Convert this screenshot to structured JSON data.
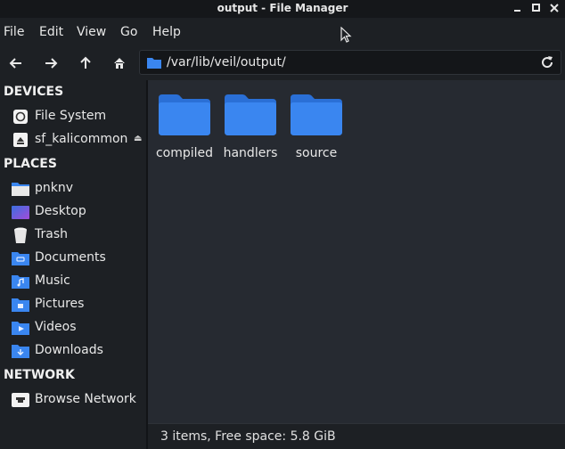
{
  "window": {
    "title": "output - File Manager"
  },
  "menubar": {
    "items": [
      "File",
      "Edit",
      "View",
      "Go",
      "Help"
    ]
  },
  "toolbar": {
    "back_icon": "arrow-left-icon",
    "forward_icon": "arrow-right-icon",
    "up_icon": "arrow-up-icon",
    "home_icon": "home-icon",
    "path": "/var/lib/veil/output/",
    "reload_icon": "reload-icon"
  },
  "sidebar": {
    "devices_header": "DEVICES",
    "devices": [
      {
        "label": "File System",
        "icon": "drive-icon"
      },
      {
        "label": "sf_kalicommon",
        "icon": "removable-drive-icon"
      }
    ],
    "places_header": "PLACES",
    "places": [
      {
        "label": "pnknv",
        "icon": "home-folder-icon"
      },
      {
        "label": "Desktop",
        "icon": "desktop-icon"
      },
      {
        "label": "Trash",
        "icon": "trash-icon"
      },
      {
        "label": "Documents",
        "icon": "documents-folder-icon"
      },
      {
        "label": "Music",
        "icon": "music-folder-icon"
      },
      {
        "label": "Pictures",
        "icon": "pictures-folder-icon"
      },
      {
        "label": "Videos",
        "icon": "videos-folder-icon"
      },
      {
        "label": "Downloads",
        "icon": "downloads-folder-icon"
      }
    ],
    "network_header": "NETWORK",
    "network": [
      {
        "label": "Browse Network",
        "icon": "network-icon"
      }
    ]
  },
  "files": [
    {
      "name": "compiled",
      "icon": "folder-icon"
    },
    {
      "name": "handlers",
      "icon": "folder-icon"
    },
    {
      "name": "source",
      "icon": "folder-icon"
    }
  ],
  "status": {
    "text": "3 items, Free space: 5.8 GiB"
  },
  "colors": {
    "accent": "#2f7de1",
    "folder": "#3a86f0",
    "background": "#262a31",
    "sidebar": "#1d2024"
  }
}
